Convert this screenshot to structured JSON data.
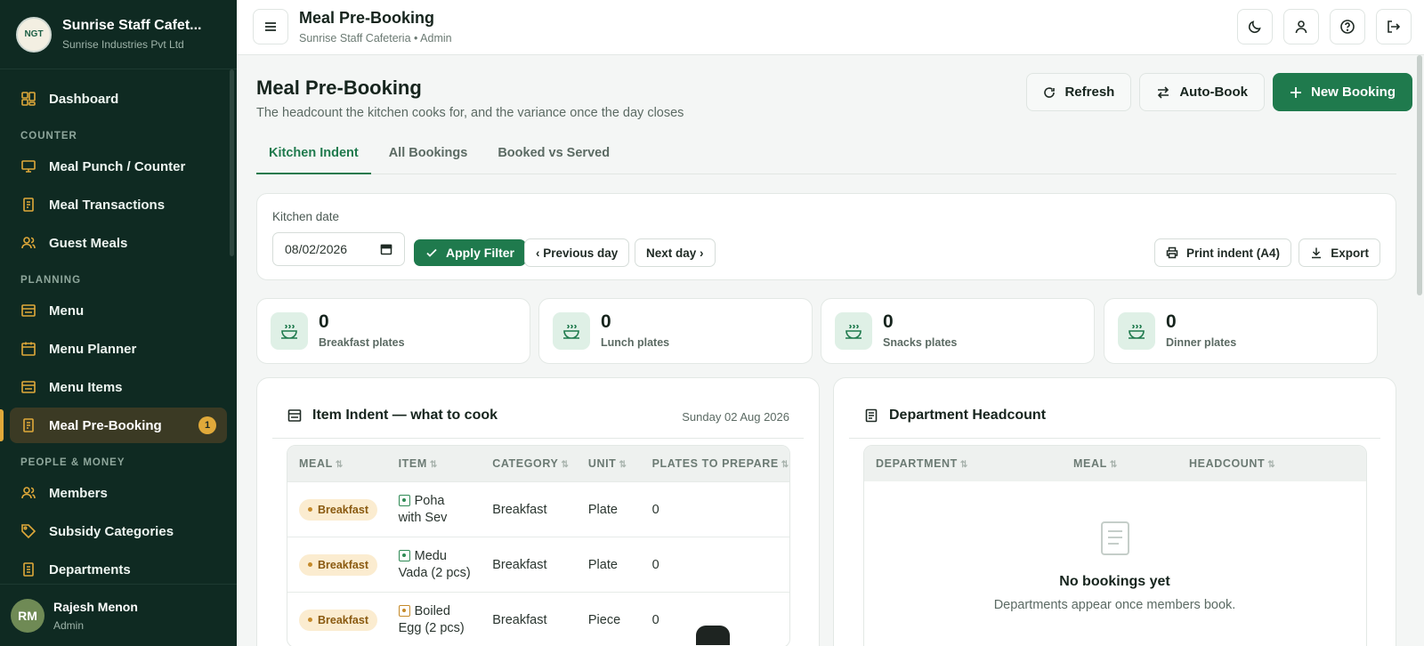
{
  "brand": {
    "title": "Sunrise Staff Cafet...",
    "subtitle": "Sunrise Industries Pvt Ltd",
    "logo_text": "NGT"
  },
  "sidebar": {
    "dashboard": "Dashboard",
    "sections": {
      "counter": "COUNTER",
      "planning": "PLANNING",
      "people": "PEOPLE & MONEY"
    },
    "items": {
      "meal_punch": "Meal Punch / Counter",
      "meal_transactions": "Meal Transactions",
      "guest_meals": "Guest Meals",
      "menu": "Menu",
      "menu_planner": "Menu Planner",
      "menu_items": "Menu Items",
      "meal_prebooking": "Meal Pre-Booking",
      "members": "Members",
      "subsidy_categories": "Subsidy Categories",
      "departments": "Departments"
    },
    "prebooking_badge": "1"
  },
  "user": {
    "initials": "RM",
    "name": "Rajesh Menon",
    "role": "Admin"
  },
  "topbar": {
    "title": "Meal Pre-Booking",
    "subtitle": "Sunrise Staff Cafeteria • Admin"
  },
  "page": {
    "title": "Meal Pre-Booking",
    "subtitle": "The headcount the kitchen cooks for, and the variance once the day closes"
  },
  "actions": {
    "refresh": "Refresh",
    "auto_book": "Auto-Book",
    "new_booking": "New Booking"
  },
  "tabs": [
    "Kitchen Indent",
    "All Bookings",
    "Booked vs Served"
  ],
  "filter": {
    "label": "Kitchen date",
    "date_value": "08/02/2026",
    "apply": "Apply Filter",
    "prev": "‹ Previous day",
    "next": "Next day ›",
    "print": "Print indent (A4)",
    "export": "Export"
  },
  "stats": [
    {
      "value": "0",
      "label": "Breakfast plates"
    },
    {
      "value": "0",
      "label": "Lunch plates"
    },
    {
      "value": "0",
      "label": "Snacks plates"
    },
    {
      "value": "0",
      "label": "Dinner plates"
    }
  ],
  "indent": {
    "title": "Item Indent — what to cook",
    "date": "Sunday 02 Aug 2026",
    "columns": [
      "MEAL",
      "ITEM",
      "CATEGORY",
      "UNIT",
      "PLATES TO PREPARE"
    ],
    "rows": [
      {
        "meal": "Breakfast",
        "item_line1": "Poha",
        "item_line2": "with Sev",
        "category": "Breakfast",
        "unit": "Plate",
        "plates": "0",
        "type": "veg"
      },
      {
        "meal": "Breakfast",
        "item_line1": "Medu",
        "item_line2": "Vada (2 pcs)",
        "category": "Breakfast",
        "unit": "Plate",
        "plates": "0",
        "type": "veg"
      },
      {
        "meal": "Breakfast",
        "item_line1": "Boiled",
        "item_line2": "Egg (2 pcs)",
        "category": "Breakfast",
        "unit": "Piece",
        "plates": "0",
        "type": "egg"
      }
    ]
  },
  "headcount": {
    "title": "Department Headcount",
    "columns": [
      "DEPARTMENT",
      "MEAL",
      "HEADCOUNT"
    ],
    "empty_title": "No bookings yet",
    "empty_sub": "Departments appear once members book."
  },
  "colors": {
    "sidebar_bg": "#0f2a22",
    "accent_green": "#1f7a4d",
    "active_amber": "#e0a93a"
  }
}
